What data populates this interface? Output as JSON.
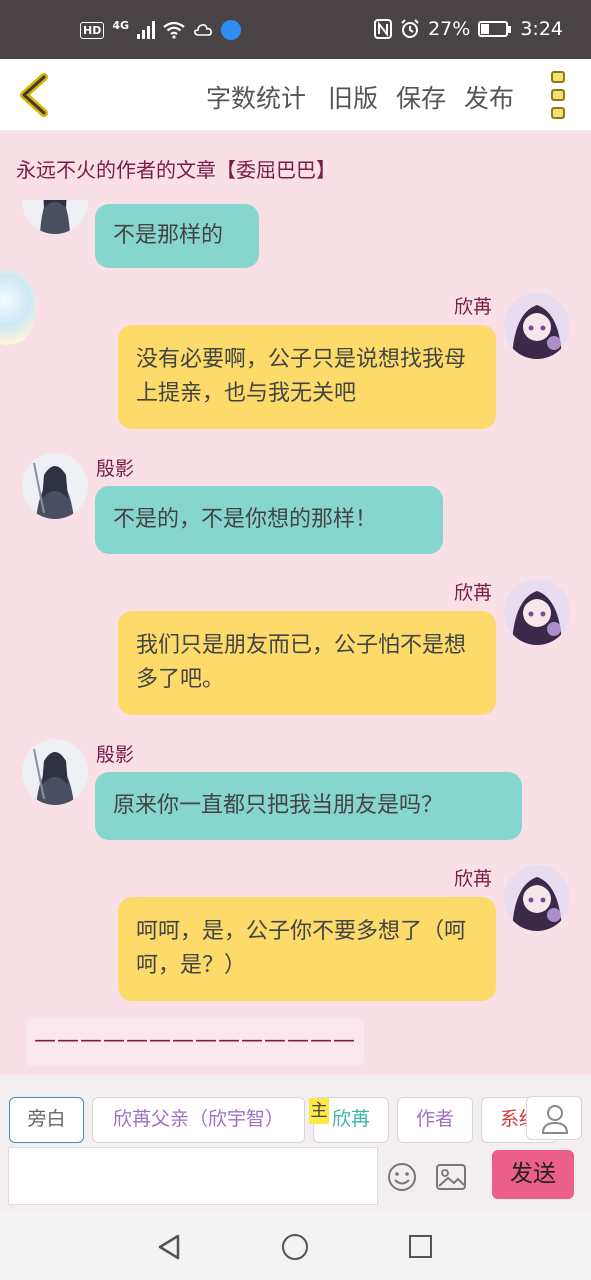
{
  "status_bar": {
    "network": "4G",
    "battery": "27%",
    "time": "3:24"
  },
  "header": {
    "menu": [
      "字数统计",
      "旧版",
      "保存",
      "发布"
    ]
  },
  "article_title": "永远不火的作者的文章【委屈巴巴】",
  "messages": [
    {
      "speaker": "",
      "text": "不是那样的",
      "side": "left"
    },
    {
      "speaker": "欣苒",
      "text": "没有必要啊，公子只是说想找我母上提亲，也与我无关吧",
      "side": "right"
    },
    {
      "speaker": "殷影",
      "text": "不是的，不是你想的那样！",
      "side": "left"
    },
    {
      "speaker": "欣苒",
      "text": "我们只是朋友而已，公子怕不是想多了吧。",
      "side": "right"
    },
    {
      "speaker": "殷影",
      "text": "原来你一直都只把我当朋友是吗？",
      "side": "left"
    },
    {
      "speaker": "欣苒",
      "text": "呵呵，是，公子你不要多想了（呵呵，是？）",
      "side": "right"
    }
  ],
  "divider_text": "——————————————",
  "roles": [
    {
      "label": "旁白",
      "color": "#666666"
    },
    {
      "label": "欣苒父亲（欣宇智）",
      "color": "#a070c8"
    },
    {
      "label": "欣苒",
      "color": "#3bb6a8",
      "badge": "主"
    },
    {
      "label": "作者",
      "color": "#a070c8"
    },
    {
      "label": "系统",
      "color": "#d23c3c"
    }
  ],
  "input": {
    "placeholder": ""
  },
  "send_label": "发送",
  "colors": {
    "left_bubble": "#86d6cd",
    "right_bubble": "#fcdb6b",
    "send": "#ec5f8b",
    "name": "#7a1c4a"
  }
}
